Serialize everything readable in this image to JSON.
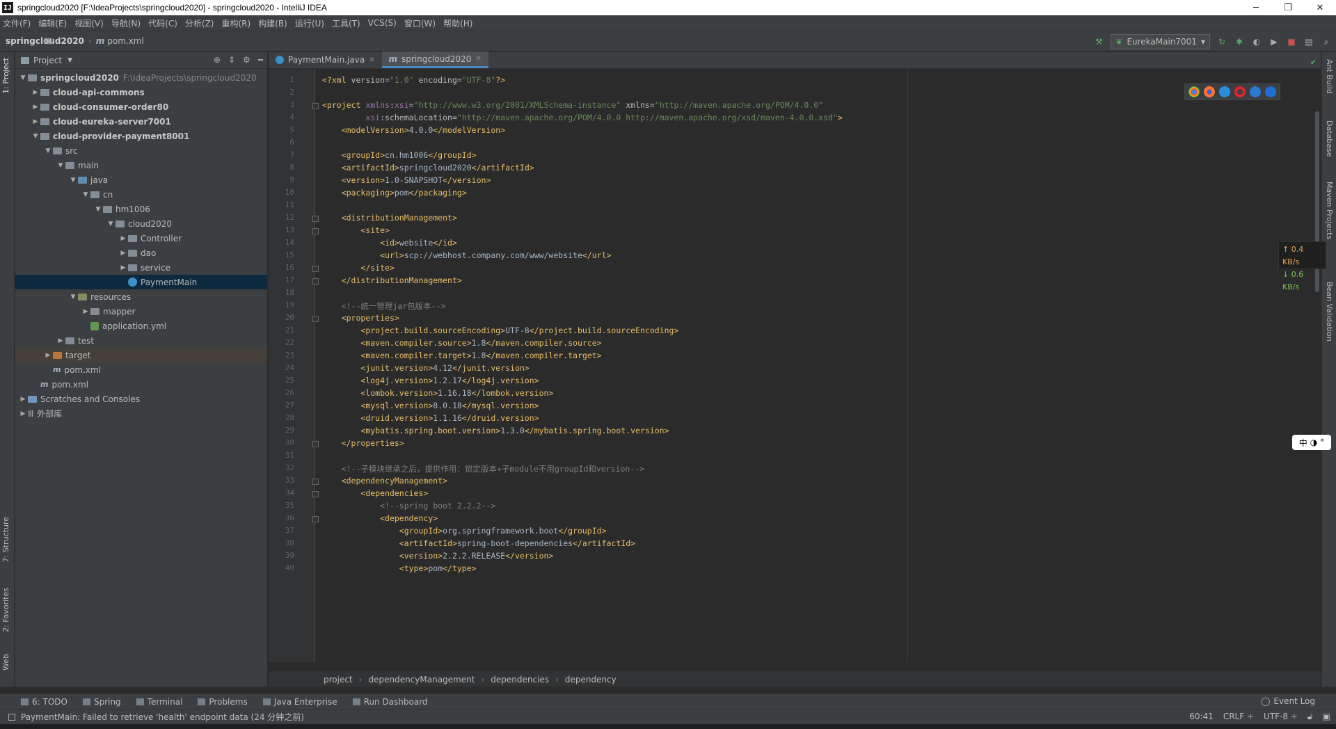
{
  "window": {
    "title": "springcloud2020 [F:\\IdeaProjects\\springcloud2020] - springcloud2020 - IntelliJ IDEA",
    "logo": "IJ"
  },
  "menu": [
    "文件(F)",
    "编辑(E)",
    "视图(V)",
    "导航(N)",
    "代码(C)",
    "分析(Z)",
    "重构(R)",
    "构建(B)",
    "运行(U)",
    "工具(T)",
    "VCS(S)",
    "窗口(W)",
    "帮助(H)"
  ],
  "nav": {
    "project": "springcloud2020",
    "file": "pom.xml",
    "run_config": "EurekaMain7001"
  },
  "left_tabs": {
    "project": "1: Project",
    "structure": "7: Structure",
    "favorites": "2: Favorites",
    "web": "Web"
  },
  "right_tabs": {
    "ant": "Ant Build",
    "database": "Database",
    "maven": "Maven Projects",
    "bean": "Bean Validation"
  },
  "project_panel": {
    "title": "Project",
    "tree": [
      {
        "label": "springcloud2020",
        "extra": "F:\\IdeaProjects\\springcloud2020",
        "depth": 0,
        "arrow": "open",
        "icon": "folder",
        "bold": true
      },
      {
        "label": "cloud-api-commons",
        "depth": 1,
        "arrow": "closed",
        "icon": "folder",
        "bold": true
      },
      {
        "label": "cloud-consumer-order80",
        "depth": 1,
        "arrow": "closed",
        "icon": "folder",
        "bold": true
      },
      {
        "label": "cloud-eureka-server7001",
        "depth": 1,
        "arrow": "closed",
        "icon": "folder",
        "bold": true
      },
      {
        "label": "cloud-provider-payment8001",
        "depth": 1,
        "arrow": "open",
        "icon": "folder",
        "bold": true
      },
      {
        "label": "src",
        "depth": 2,
        "arrow": "open",
        "icon": "folder"
      },
      {
        "label": "main",
        "depth": 3,
        "arrow": "open",
        "icon": "folder"
      },
      {
        "label": "java",
        "depth": 4,
        "arrow": "open",
        "icon": "src"
      },
      {
        "label": "cn",
        "depth": 5,
        "arrow": "open",
        "icon": "folder"
      },
      {
        "label": "hm1006",
        "depth": 6,
        "arrow": "open",
        "icon": "folder"
      },
      {
        "label": "cloud2020",
        "depth": 7,
        "arrow": "open",
        "icon": "folder"
      },
      {
        "label": "Controller",
        "depth": 8,
        "arrow": "closed",
        "icon": "folder"
      },
      {
        "label": "dao",
        "depth": 8,
        "arrow": "closed",
        "icon": "folder"
      },
      {
        "label": "service",
        "depth": 8,
        "arrow": "closed",
        "icon": "folder"
      },
      {
        "label": "PaymentMain",
        "depth": 8,
        "arrow": "none",
        "icon": "class",
        "selected": true
      },
      {
        "label": "resources",
        "depth": 4,
        "arrow": "open",
        "icon": "res"
      },
      {
        "label": "mapper",
        "depth": 5,
        "arrow": "closed",
        "icon": "folder"
      },
      {
        "label": "application.yml",
        "depth": 5,
        "arrow": "none",
        "icon": "yml"
      },
      {
        "label": "test",
        "depth": 3,
        "arrow": "closed",
        "icon": "folder"
      },
      {
        "label": "target",
        "depth": 2,
        "arrow": "closed",
        "icon": "target",
        "highlight": true
      },
      {
        "label": "pom.xml",
        "depth": 2,
        "arrow": "none",
        "icon": "xml"
      },
      {
        "label": "pom.xml",
        "depth": 1,
        "arrow": "none",
        "icon": "xml"
      },
      {
        "label": "Scratches and Consoles",
        "depth": 0,
        "arrow": "closed",
        "icon": "blue"
      },
      {
        "label": "外部库",
        "depth": 0,
        "arrow": "closed",
        "icon": "lib"
      }
    ]
  },
  "tabs": [
    {
      "label": "PaymentMain.java",
      "active": false
    },
    {
      "label": "springcloud2020",
      "active": true
    }
  ],
  "code_lines": [
    [
      [
        "tg",
        "<?xml "
      ],
      [
        "at",
        "version"
      ],
      [
        "",
        "="
      ],
      [
        "vl",
        "\"1.0\""
      ],
      [
        "at",
        " encoding"
      ],
      [
        "",
        "="
      ],
      [
        "vl",
        "\"UTF-8\""
      ],
      [
        "tg",
        "?>"
      ]
    ],
    [],
    [
      [
        "tg",
        "<project "
      ],
      [
        "ns",
        "xmlns"
      ],
      [
        "",
        ":"
      ],
      [
        "ns",
        "xsi"
      ],
      [
        "",
        "="
      ],
      [
        "vl",
        "\"http://www.w3.org/2001/XMLSchema-instance\""
      ],
      [
        "at",
        " xmlns"
      ],
      [
        "",
        "="
      ],
      [
        "vl",
        "\"http://maven.apache.org/POM/4.0.0\""
      ]
    ],
    [
      [
        "",
        "         "
      ],
      [
        "ns",
        "xsi"
      ],
      [
        "",
        ":"
      ],
      [
        "at",
        "schemaLocation"
      ],
      [
        "",
        "="
      ],
      [
        "vl",
        "\"http://maven.apache.org/POM/4.0.0 http://maven.apache.org/xsd/maven-4.0.0.xsd\""
      ],
      [
        "tg",
        ">"
      ]
    ],
    [
      [
        "",
        "    "
      ],
      [
        "tg",
        "<modelVersion>"
      ],
      [
        "",
        "4.0.0"
      ],
      [
        "tg",
        "</modelVersion>"
      ]
    ],
    [],
    [
      [
        "",
        "    "
      ],
      [
        "tg",
        "<groupId>"
      ],
      [
        "",
        "cn.hm1006"
      ],
      [
        "tg",
        "</groupId>"
      ]
    ],
    [
      [
        "",
        "    "
      ],
      [
        "tg",
        "<artifactId>"
      ],
      [
        "",
        "springcloud2020"
      ],
      [
        "tg",
        "</artifactId>"
      ]
    ],
    [
      [
        "",
        "    "
      ],
      [
        "tg",
        "<version>"
      ],
      [
        "",
        "1.0-SNAPSHOT"
      ],
      [
        "tg",
        "</version>"
      ]
    ],
    [
      [
        "",
        "    "
      ],
      [
        "tg",
        "<packaging>"
      ],
      [
        "",
        "pom"
      ],
      [
        "tg",
        "</packaging>"
      ]
    ],
    [],
    [
      [
        "",
        "    "
      ],
      [
        "tg",
        "<distributionManagement>"
      ]
    ],
    [
      [
        "",
        "        "
      ],
      [
        "tg",
        "<site>"
      ]
    ],
    [
      [
        "",
        "            "
      ],
      [
        "tg",
        "<id>"
      ],
      [
        "",
        "website"
      ],
      [
        "tg",
        "</id>"
      ]
    ],
    [
      [
        "",
        "            "
      ],
      [
        "tg",
        "<url>"
      ],
      [
        "",
        "scp://webhost.company.com/www/website"
      ],
      [
        "tg",
        "</url>"
      ]
    ],
    [
      [
        "",
        "        "
      ],
      [
        "tg",
        "</site>"
      ]
    ],
    [
      [
        "",
        "    "
      ],
      [
        "tg",
        "</distributionManagement>"
      ]
    ],
    [],
    [
      [
        "",
        "    "
      ],
      [
        "cm",
        "<!--统一管理jar包版本-->"
      ]
    ],
    [
      [
        "",
        "    "
      ],
      [
        "tg",
        "<properties>"
      ]
    ],
    [
      [
        "",
        "        "
      ],
      [
        "tg",
        "<project.build.sourceEncoding>"
      ],
      [
        "",
        "UTF-8"
      ],
      [
        "tg",
        "</project.build.sourceEncoding>"
      ]
    ],
    [
      [
        "",
        "        "
      ],
      [
        "tg",
        "<maven.compiler.source>"
      ],
      [
        "",
        "1.8"
      ],
      [
        "tg",
        "</maven.compiler.source>"
      ]
    ],
    [
      [
        "",
        "        "
      ],
      [
        "tg",
        "<maven.compiler.target>"
      ],
      [
        "",
        "1.8"
      ],
      [
        "tg",
        "</maven.compiler.target>"
      ]
    ],
    [
      [
        "",
        "        "
      ],
      [
        "tg",
        "<junit.version>"
      ],
      [
        "",
        "4.12"
      ],
      [
        "tg",
        "</junit.version>"
      ]
    ],
    [
      [
        "",
        "        "
      ],
      [
        "tg",
        "<log4j.version>"
      ],
      [
        "",
        "1.2.17"
      ],
      [
        "tg",
        "</log4j.version>"
      ]
    ],
    [
      [
        "",
        "        "
      ],
      [
        "tg",
        "<lombok.version>"
      ],
      [
        "",
        "1.16.18"
      ],
      [
        "tg",
        "</lombok.version>"
      ]
    ],
    [
      [
        "",
        "        "
      ],
      [
        "tg",
        "<mysql.version>"
      ],
      [
        "",
        "8.0.18"
      ],
      [
        "tg",
        "</mysql.version>"
      ]
    ],
    [
      [
        "",
        "        "
      ],
      [
        "tg",
        "<druid.version>"
      ],
      [
        "",
        "1.1.16"
      ],
      [
        "tg",
        "</druid.version>"
      ]
    ],
    [
      [
        "",
        "        "
      ],
      [
        "tg",
        "<mybatis.spring.boot.version>"
      ],
      [
        "",
        "1.3.0"
      ],
      [
        "tg",
        "</mybatis.spring.boot.version>"
      ]
    ],
    [
      [
        "",
        "    "
      ],
      [
        "tg",
        "</properties>"
      ]
    ],
    [],
    [
      [
        "",
        "    "
      ],
      [
        "cm",
        "<!--子模块继承之后，提供作用：锁定版本+子module不用groupId和version-->"
      ]
    ],
    [
      [
        "",
        "    "
      ],
      [
        "tg",
        "<dependencyManagement>"
      ]
    ],
    [
      [
        "",
        "        "
      ],
      [
        "tg",
        "<dependencies>"
      ]
    ],
    [
      [
        "",
        "            "
      ],
      [
        "cm",
        "<!--spring boot 2.2.2-->"
      ]
    ],
    [
      [
        "",
        "            "
      ],
      [
        "tg",
        "<dependency>"
      ]
    ],
    [
      [
        "",
        "                "
      ],
      [
        "tg",
        "<groupId>"
      ],
      [
        "",
        "org.springframework.boot"
      ],
      [
        "tg",
        "</groupId>"
      ]
    ],
    [
      [
        "",
        "                "
      ],
      [
        "tg",
        "<artifactId>"
      ],
      [
        "",
        "spring-boot-dependencies"
      ],
      [
        "tg",
        "</artifactId>"
      ]
    ],
    [
      [
        "",
        "                "
      ],
      [
        "tg",
        "<version>"
      ],
      [
        "",
        "2.2.2.RELEASE"
      ],
      [
        "tg",
        "</version>"
      ]
    ],
    [
      [
        "",
        "                "
      ],
      [
        "tg",
        "<type>"
      ],
      [
        "",
        "pom"
      ],
      [
        "tg",
        "</type>"
      ]
    ]
  ],
  "fold_lines": [
    3,
    12,
    13,
    16,
    17,
    20,
    30,
    33,
    34,
    36
  ],
  "editor_breadcrumb": [
    "project",
    "dependencyManagement",
    "dependencies",
    "dependency"
  ],
  "network": {
    "up": "↑ 0.4 KB/s",
    "down": "↓ 0.6 KB/s"
  },
  "ime": {
    "label": "中"
  },
  "bottom_tools": [
    "6: TODO",
    "Spring",
    "Terminal",
    "Problems",
    "Java Enterprise",
    "Run Dashboard"
  ],
  "event_log": "Event Log",
  "status": {
    "message": "PaymentMain: Failed to retrieve 'health' endpoint data (24 分钟之前)",
    "position": "60:41",
    "line_sep": "CRLF ÷",
    "encoding": "UTF-8 ÷"
  },
  "colors": {
    "bg": "#2b2b2b",
    "panel": "#3c3f41",
    "tag": "#e8bf6a",
    "string": "#6a8759",
    "comment": "#808080",
    "namespace": "#9876aa",
    "selection": "#0d293e"
  }
}
